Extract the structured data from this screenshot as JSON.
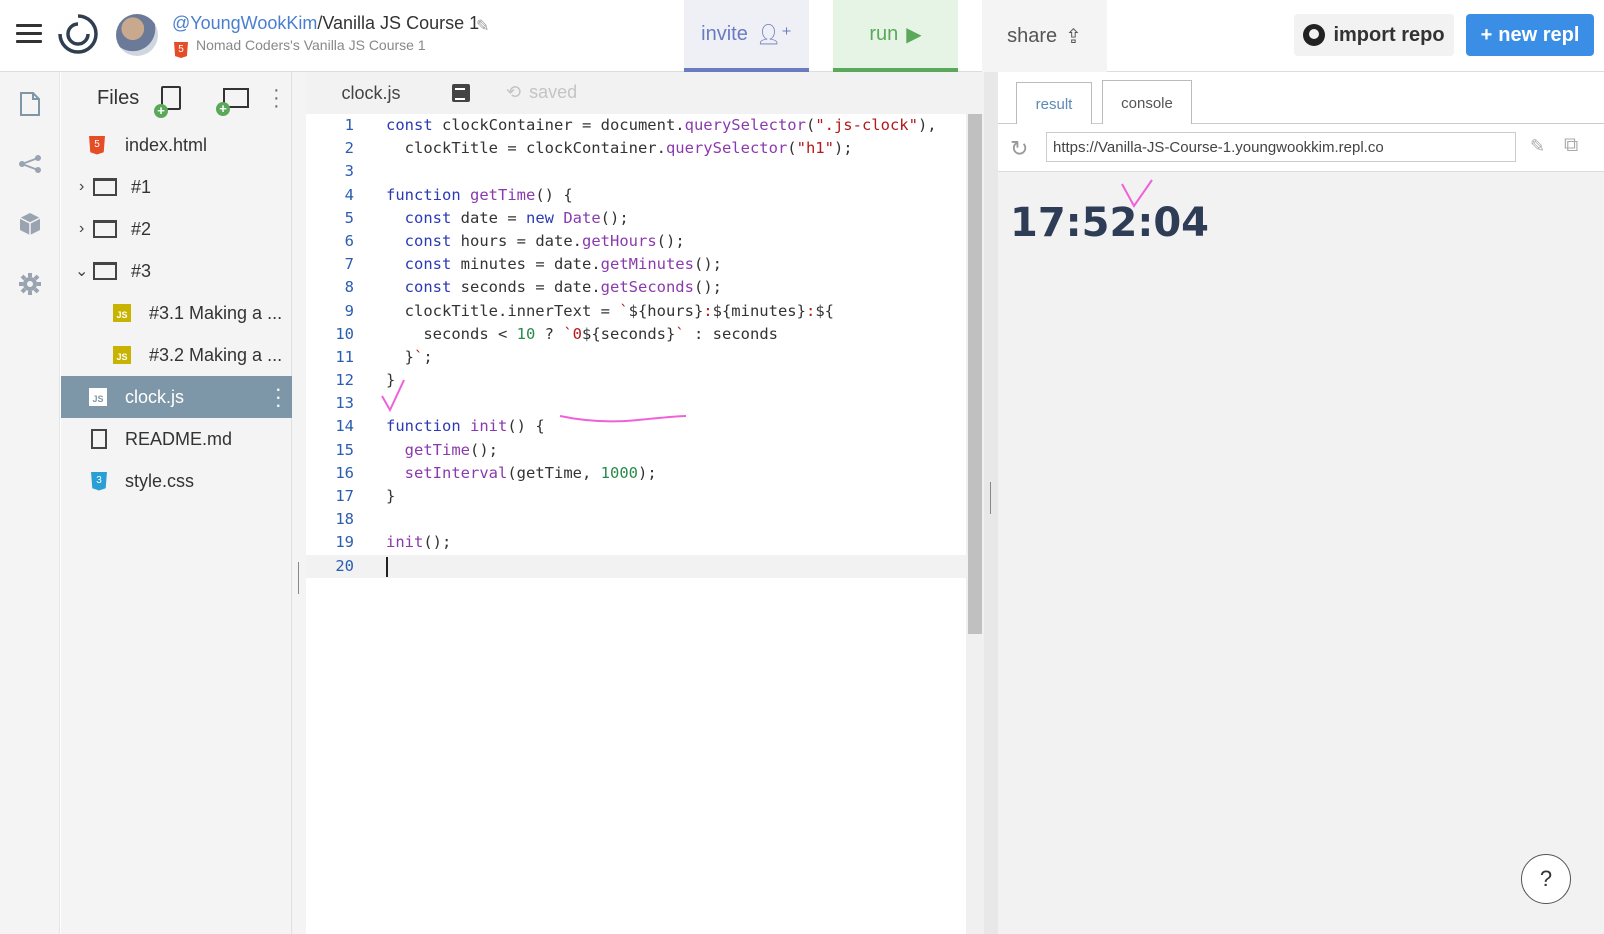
{
  "header": {
    "user": "@YoungWookKim",
    "repl_name": "/Vanilla JS Course 1",
    "subtitle": "Nomad Coders's Vanilla JS Course 1",
    "invite_label": "invite",
    "run_label": "run",
    "share_label": "share",
    "import_label": "import repo",
    "new_label": "new repl"
  },
  "files": {
    "title": "Files",
    "items": [
      {
        "label": "index.html",
        "icon": "html5-icon"
      },
      {
        "label": "#1",
        "icon": "folder-icon"
      },
      {
        "label": "#2",
        "icon": "folder-icon"
      },
      {
        "label": "#3",
        "icon": "folder-icon"
      },
      {
        "label": "#3.1 Making a ...",
        "icon": "js-icon"
      },
      {
        "label": "#3.2 Making a ...",
        "icon": "js-icon"
      },
      {
        "label": "clock.js",
        "icon": "js-icon"
      },
      {
        "label": "README.md",
        "icon": "doc-icon"
      },
      {
        "label": "style.css",
        "icon": "css3-icon"
      }
    ]
  },
  "editor": {
    "tab_label": "clock.js",
    "status": "saved",
    "line_numbers": [
      "1",
      "2",
      "3",
      "4",
      "5",
      "6",
      "7",
      "8",
      "9",
      "10",
      "11",
      "12",
      "13",
      "14",
      "15",
      "16",
      "17",
      "18",
      "19",
      "20"
    ]
  },
  "result": {
    "tabs": [
      "result",
      "console"
    ],
    "url": "https://Vanilla-JS-Course-1.youngwookkim.repl.co",
    "clock_text": "17:52:04",
    "help_label": "?"
  },
  "colors": {
    "accent_blue": "#3a8ee6",
    "run_green": "#5aa85a",
    "invite_purple": "#6a7bc0",
    "active_file": "#7d97a8",
    "annotation_pink": "#f060d8"
  }
}
